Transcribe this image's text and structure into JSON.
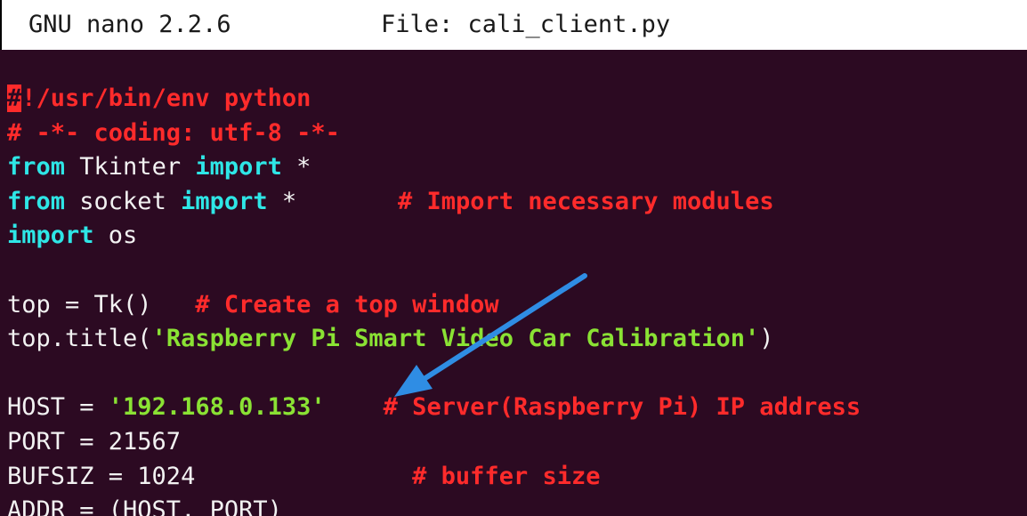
{
  "titlebar": {
    "app_name": "GNU nano 2.2.6",
    "file_label": "File: cali_client.py"
  },
  "colors": {
    "background": "#2c0a22",
    "keyword": "#2ee6e6",
    "comment": "#ff2b2b",
    "string": "#8ae234",
    "plain": "#f2f2f2",
    "cursor": "#ff2b2b",
    "annotation_arrow": "#2f8de4"
  },
  "annotation": {
    "icon": "arrow-icon",
    "points_to": "HOST string literal"
  },
  "lines": [
    [
      {
        "c": "cursor",
        "t": "#"
      },
      {
        "c": "shebang",
        "t": "!/usr/bin/env python"
      }
    ],
    [
      {
        "c": "comment",
        "t": "# -*- coding: utf-8 -*-"
      }
    ],
    [
      {
        "c": "kw",
        "t": "from"
      },
      {
        "c": "plain",
        "t": " Tkinter "
      },
      {
        "c": "kw",
        "t": "import"
      },
      {
        "c": "plain",
        "t": " *"
      }
    ],
    [
      {
        "c": "kw",
        "t": "from"
      },
      {
        "c": "plain",
        "t": " socket "
      },
      {
        "c": "kw",
        "t": "import"
      },
      {
        "c": "plain",
        "t": " *       "
      },
      {
        "c": "comment",
        "t": "# Import necessary modules"
      }
    ],
    [
      {
        "c": "kw",
        "t": "import"
      },
      {
        "c": "plain",
        "t": " os"
      }
    ],
    [],
    [
      {
        "c": "plain",
        "t": "top = Tk()   "
      },
      {
        "c": "comment",
        "t": "# Create a top window"
      }
    ],
    [
      {
        "c": "plain",
        "t": "top.title("
      },
      {
        "c": "string",
        "t": "'Raspberry Pi Smart Video Car Calibration'"
      },
      {
        "c": "plain",
        "t": ")"
      }
    ],
    [],
    [
      {
        "c": "plain",
        "t": "HOST = "
      },
      {
        "c": "string",
        "t": "'192.168.0.133'"
      },
      {
        "c": "plain",
        "t": "    "
      },
      {
        "c": "comment",
        "t": "# Server(Raspberry Pi) IP address"
      }
    ],
    [
      {
        "c": "plain",
        "t": "PORT = 21567"
      }
    ],
    [
      {
        "c": "plain",
        "t": "BUFSIZ = 1024               "
      },
      {
        "c": "comment",
        "t": "# buffer size"
      }
    ],
    [
      {
        "c": "plain",
        "t": "ADDR = (HOST, PORT)"
      }
    ]
  ]
}
